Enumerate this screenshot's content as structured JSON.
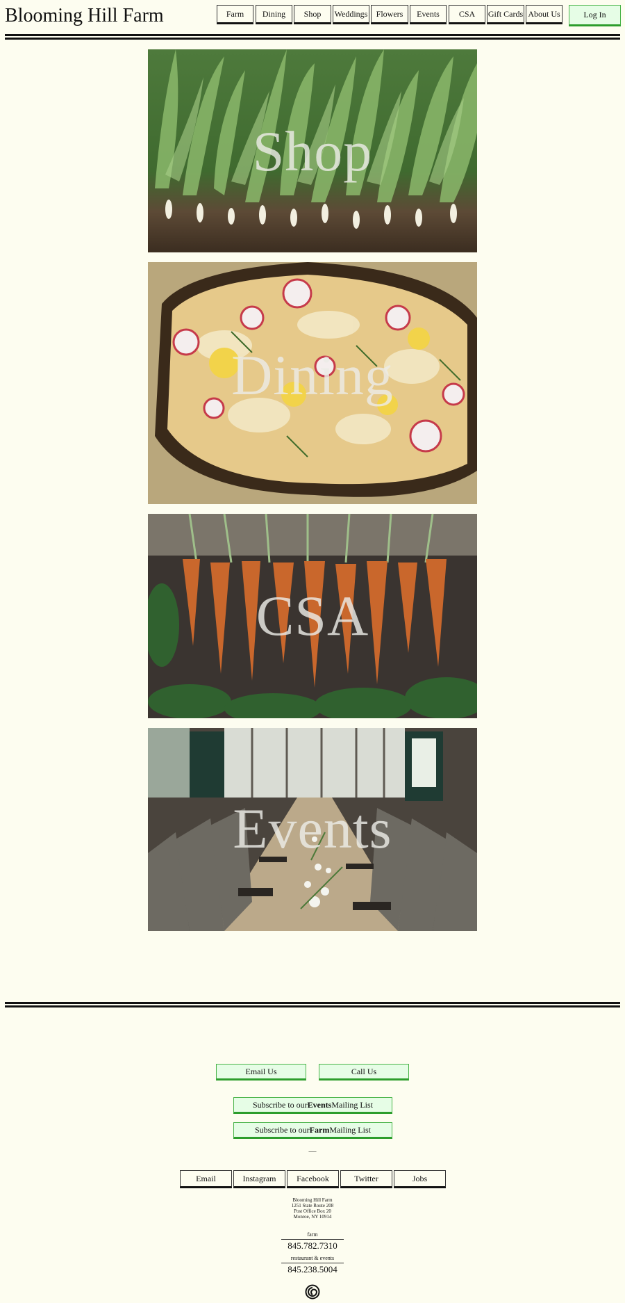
{
  "site": {
    "title": "Blooming Hill Farm"
  },
  "nav": {
    "items": [
      "Farm",
      "Dining",
      "Shop",
      "Weddings",
      "Flowers",
      "Events",
      "CSA",
      "Gift Cards",
      "About Us"
    ],
    "login": "Log In"
  },
  "tiles": {
    "shop": "Shop",
    "dining": "Dining",
    "csa": "CSA",
    "events": "Events"
  },
  "footer": {
    "email_us": "Email Us",
    "call_us": "Call Us",
    "subscribe_events_pre": "Subscribe to our",
    "subscribe_events_bold": "Events",
    "subscribe_events_post": "Mailing List",
    "subscribe_farm_pre": "Subscribe to our",
    "subscribe_farm_bold": "Farm",
    "subscribe_farm_post": "Mailing List",
    "divider": "—",
    "social": [
      "Email",
      "Instagram",
      "Facebook",
      "Twitter",
      "Jobs"
    ],
    "address": [
      "Blooming Hill Farm",
      "1251 State Route 208",
      "Post Office Box 20",
      "Monroe, NY 10914"
    ],
    "farm_label": "farm",
    "farm_phone": "845.782.7310",
    "restaurant_label": "restaurant & events",
    "restaurant_phone": "845.238.5004"
  },
  "icons": {
    "logo": "spiral-logo-icon"
  }
}
